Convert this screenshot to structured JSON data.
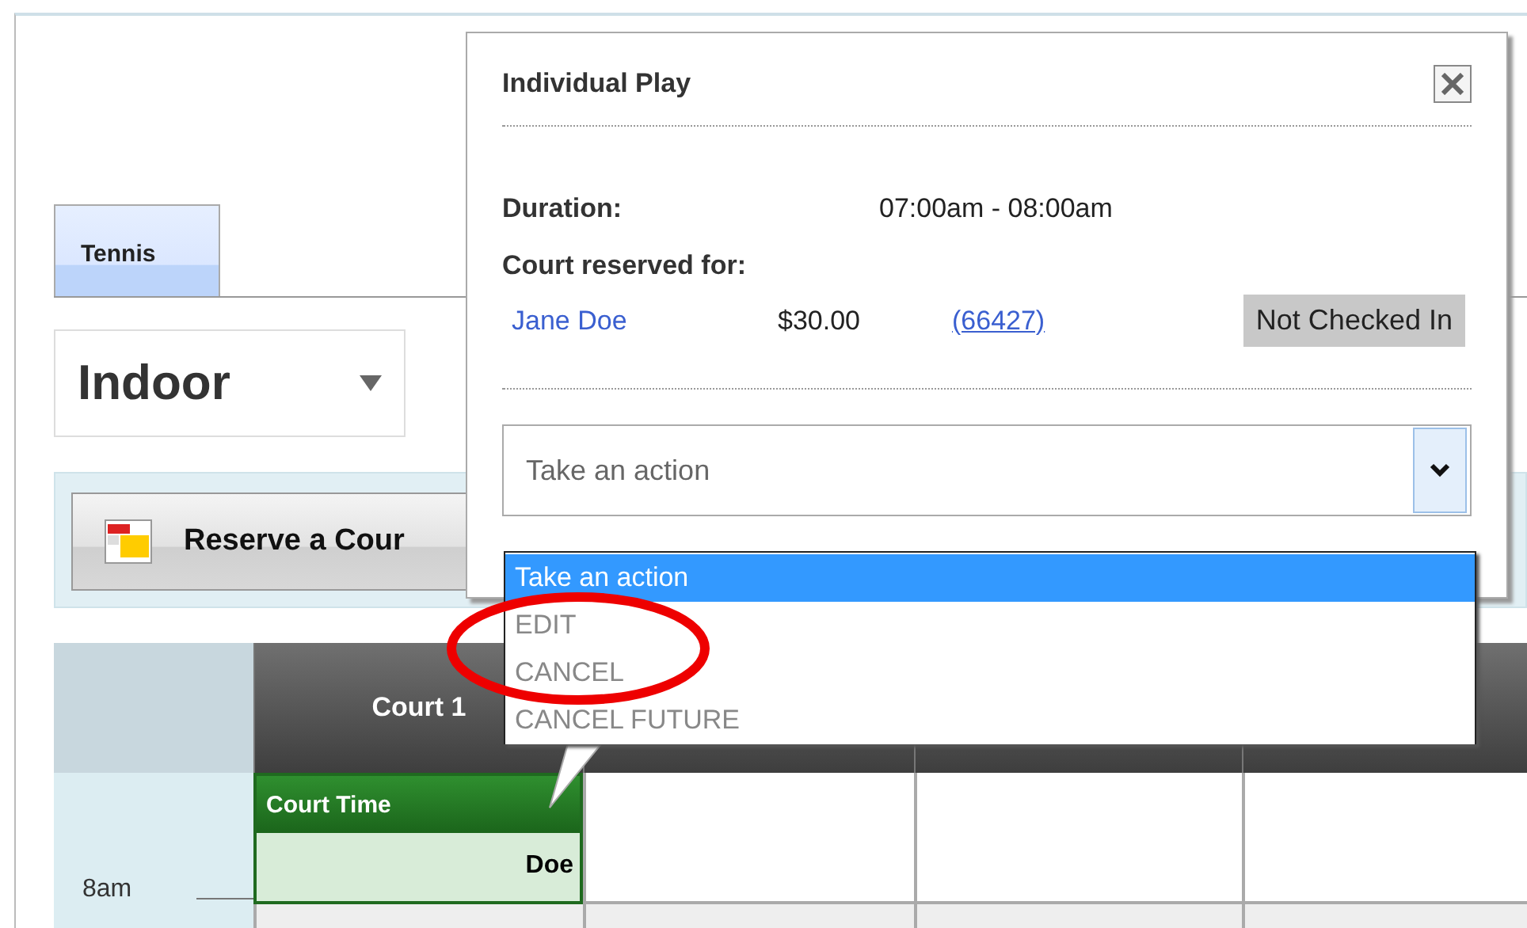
{
  "tabs": [
    {
      "label": "Tennis",
      "selected": true
    }
  ],
  "location_select": {
    "value": "Indoor"
  },
  "toolbar": {
    "reserve_button": "Reserve a Cour"
  },
  "schedule": {
    "court_headers": [
      "Court 1"
    ],
    "time_labels": [
      "8am"
    ],
    "booking": {
      "title": "Court Time",
      "name": "Doe"
    }
  },
  "popup": {
    "title": "Individual Play",
    "duration_label": "Duration:",
    "duration": "07:00am - 08:00am",
    "reserved_label": "Court reserved for:",
    "reservation": {
      "name": "Jane Doe",
      "price": "$30.00",
      "id": "(66427)",
      "status": "Not Checked In"
    },
    "action_select": {
      "value": "Take an action",
      "expanded": true,
      "options": [
        {
          "label": "Take an action",
          "selected": true
        },
        {
          "label": "EDIT",
          "selected": false
        },
        {
          "label": "CANCEL",
          "selected": false
        },
        {
          "label": "CANCEL FUTURE",
          "selected": false
        }
      ]
    }
  }
}
